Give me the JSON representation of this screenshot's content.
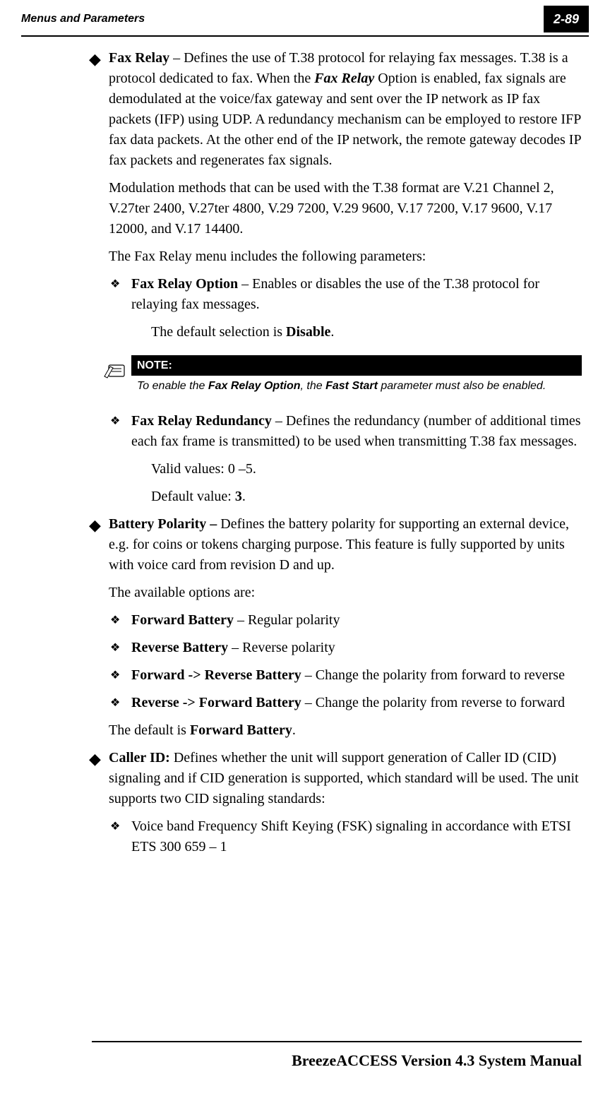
{
  "header": {
    "left": "Menus and Parameters",
    "badge": "2-89"
  },
  "faxRelay": {
    "title": "Fax Relay",
    "p1a": " – Defines the use of T.38 protocol for relaying fax messages. T.38 is a protocol dedicated to fax. When the ",
    "boldItalic": "Fax Relay",
    "p1b": " Option is enabled, fax signals are demodulated at the voice/fax gateway and sent over the IP network as IP fax packets (IFP) using UDP. A redundancy mechanism can be employed to restore IFP fax data packets. At the other end of the IP network, the remote gateway decodes IP fax packets and regenerates fax signals.",
    "p2": "Modulation methods that can be used with the T.38 format are V.21 Channel 2, V.27ter 2400, V.27ter 4800, V.29 7200, V.29 9600, V.17 7200, V.17 9600, V.17 12000, and V.17 14400.",
    "p3": "The Fax Relay menu includes the following parameters:",
    "option": {
      "title": "Fax Relay Option",
      "text": " – Enables or disables the use of the T.38 protocol for relaying fax messages.",
      "default_pre": "The default selection is ",
      "default_val": "Disable",
      "default_post": "."
    },
    "note": {
      "header": "NOTE:",
      "pre": "To enable the ",
      "b1": "Fax Relay Option",
      "mid": ", the ",
      "b2": "Fast Start",
      "post": " parameter must also be enabled."
    },
    "redundancy": {
      "title": "Fax Relay Redundancy",
      "text": " – Defines the redundancy (number of additional times each fax frame is transmitted) to be used when transmitting T.38 fax messages.",
      "valid": "Valid values: 0 –5.",
      "default_pre": "Default value: ",
      "default_val": "3",
      "default_post": "."
    }
  },
  "battery": {
    "title": "Battery Polarity – ",
    "text": "Defines the battery polarity for supporting an external device, e.g. for coins or tokens charging purpose. This feature is fully supported by units with voice card from revision D and up.",
    "avail": "The available options are:",
    "opts": {
      "fwd_t": "Forward Battery",
      "fwd_x": " – Regular polarity",
      "rev_t": "Reverse Battery",
      "rev_x": " – Reverse polarity",
      "fr_t": "Forward -> Reverse Battery",
      "fr_x": " – Change the polarity from forward to reverse",
      "rf_t": "Reverse -> Forward Battery",
      "rf_x": " – Change the polarity from reverse to forward"
    },
    "default_pre": "The default is ",
    "default_val": "Forward Battery",
    "default_post": "."
  },
  "cid": {
    "title": "Caller ID: ",
    "text": "Defines whether the unit will support generation of Caller ID (CID) signaling and if CID generation is supported, which standard will be used. The unit supports two CID signaling standards:",
    "sub1": "Voice band Frequency Shift Keying (FSK) signaling in accordance with ETSI ETS 300 659 – 1"
  },
  "footer": "BreezeACCESS Version 4.3 System Manual"
}
